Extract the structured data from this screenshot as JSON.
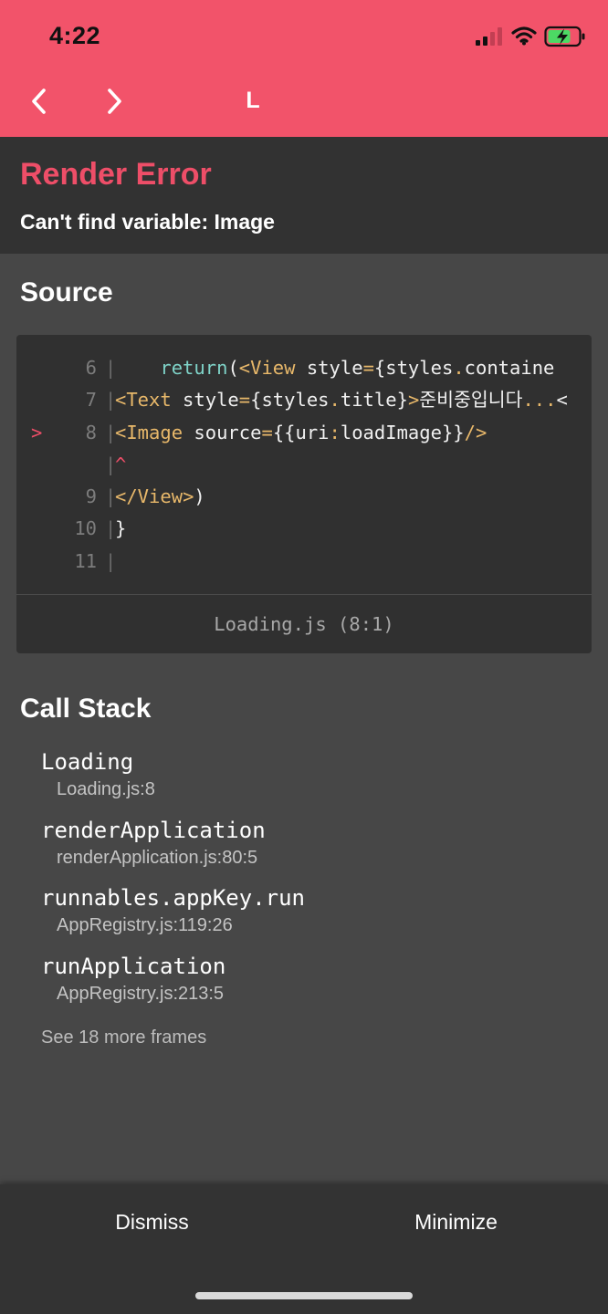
{
  "status_bar": {
    "time": "4:22"
  },
  "nav": {
    "title": "L"
  },
  "error": {
    "title": "Render Error",
    "message": "Can't find variable: Image"
  },
  "source": {
    "heading": "Source",
    "lines": [
      {
        "marker": "",
        "num": "6",
        "text": "    return(<View style={styles.containe"
      },
      {
        "marker": "",
        "num": "7",
        "text": "<Text style={styles.title}>준비중입니다...<"
      },
      {
        "marker": ">",
        "num": "8",
        "text": "<Image source={{uri:loadImage}}/>"
      },
      {
        "marker": "",
        "num": "",
        "text": "^"
      },
      {
        "marker": "",
        "num": "9",
        "text": "</View>)"
      },
      {
        "marker": "",
        "num": "10",
        "text": "}"
      },
      {
        "marker": "",
        "num": "11",
        "text": ""
      }
    ],
    "location": "Loading.js (8:1)"
  },
  "call_stack": {
    "heading": "Call Stack",
    "frames": [
      {
        "name": "Loading",
        "file": "Loading.js:8"
      },
      {
        "name": "renderApplication",
        "file": "renderApplication.js:80:5"
      },
      {
        "name": "runnables.appKey.run",
        "file": "AppRegistry.js:119:26"
      },
      {
        "name": "runApplication",
        "file": "AppRegistry.js:213:5"
      }
    ],
    "more_label": "See 18 more frames"
  },
  "actions": {
    "dismiss_label": "Dismiss",
    "minimize_label": "Minimize"
  },
  "colors": {
    "header_bg": "#f2536a",
    "error_title": "#ee4e68",
    "battery_fill": "#4cd964"
  },
  "icons": {
    "signal": "cellular-signal-icon",
    "wifi": "wifi-icon",
    "battery": "battery-charging-icon",
    "back": "chevron-left-icon",
    "forward": "chevron-right-icon"
  }
}
